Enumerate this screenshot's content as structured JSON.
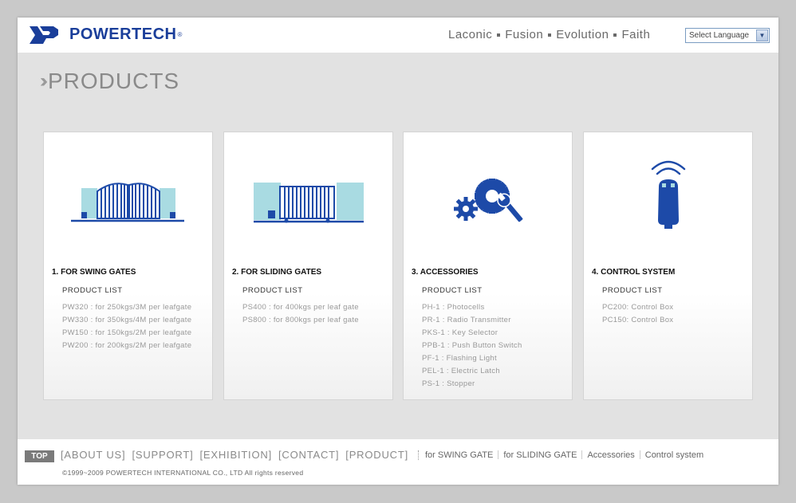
{
  "brand": {
    "name": "POWERTECH",
    "reg": "®"
  },
  "header": {
    "tagline": [
      "Laconic",
      "Fusion",
      "Evolution",
      "Faith"
    ],
    "language_select": "Select Language"
  },
  "page": {
    "title": "PRODUCTS"
  },
  "cards": [
    {
      "title": "1. FOR SWING GATES",
      "list_label": "PRODUCT LIST",
      "icon": "swing-gate-icon",
      "items": [
        "PW320 : for 250kgs/3M per leafgate",
        "PW330 : for 350kgs/4M per leafgate",
        "PW150 : for 150kgs/2M per leafgate",
        "PW200 : for 200kgs/2M per leafgate"
      ]
    },
    {
      "title": "2. FOR SLIDING GATES",
      "list_label": "PRODUCT LIST",
      "icon": "sliding-gate-icon",
      "items": [
        "PS400 : for 400kgs per leaf gate",
        "PS800 : for 800kgs per leaf gate"
      ]
    },
    {
      "title": "3. ACCESSORIES",
      "list_label": "PRODUCT LIST",
      "icon": "gears-wrench-icon",
      "items": [
        "PH-1 : Photocells",
        "PR-1 : Radio Transmitter",
        "PKS-1 : Key Selector",
        "PPB-1 : Push Button Switch",
        "PF-1 : Flashing Light",
        "PEL-1 : Electric Latch",
        "PS-1 : Stopper"
      ]
    },
    {
      "title": "4. CONTROL SYSTEM",
      "list_label": "PRODUCT LIST",
      "icon": "remote-control-icon",
      "items": [
        "PC200: Control Box",
        "PC150: Control Box"
      ]
    }
  ],
  "footer": {
    "top_label": "TOP",
    "main_links": [
      "[ABOUT US]",
      "[SUPPORT]",
      "[EXHIBITION]",
      "[CONTACT]",
      "[PRODUCT]"
    ],
    "sub_links": [
      "for SWING GATE",
      "for SLIDING GATE",
      "Accessories",
      "Control system"
    ],
    "copyright": "©1999~2009 POWERTECH INTERNATIONAL CO., LTD All rights reserved"
  },
  "colors": {
    "brand_blue": "#1a3e9a",
    "icon_blue": "#1d4aa8",
    "icon_light": "#a9dbe2"
  }
}
